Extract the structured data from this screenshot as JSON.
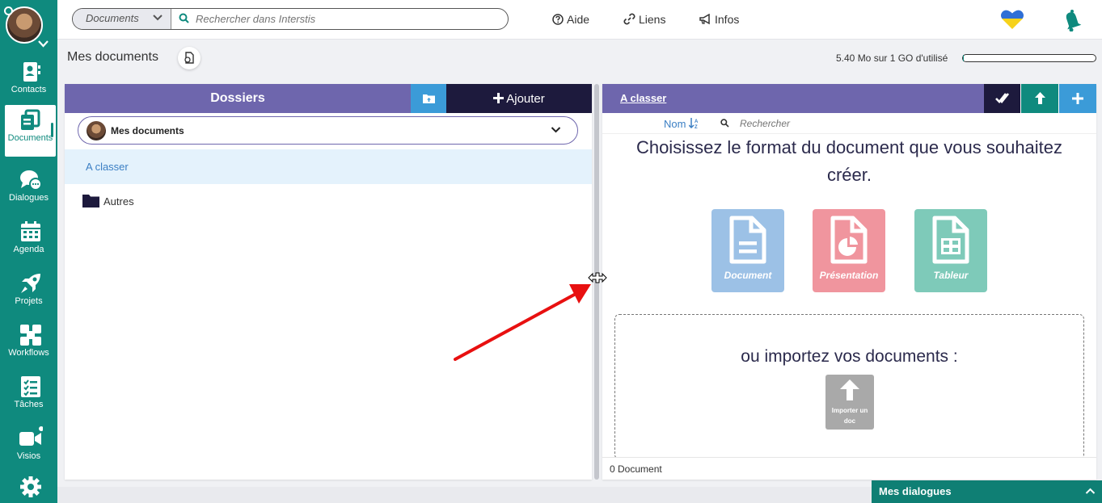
{
  "sidebar": {
    "items": [
      {
        "label": "Contacts",
        "icon": "contacts-icon"
      },
      {
        "label": "Documents",
        "icon": "documents-icon",
        "active": true
      },
      {
        "label": "Dialogues",
        "icon": "chat-icon"
      },
      {
        "label": "Agenda",
        "icon": "calendar-icon"
      },
      {
        "label": "Projets",
        "icon": "rocket-icon"
      },
      {
        "label": "Workflows",
        "icon": "workflow-icon"
      },
      {
        "label": "Tâches",
        "icon": "tasks-icon"
      },
      {
        "label": "Visios",
        "icon": "video-icon"
      }
    ],
    "settings_icon": "gear-icon"
  },
  "topbar": {
    "scope": "Documents",
    "search_placeholder": "Rechercher dans Interstis",
    "links": [
      "Aide",
      "Liens",
      "Infos"
    ]
  },
  "page": {
    "title": "Mes documents",
    "quota_text": "5.40 Mo sur 1 GO d'utilisé",
    "quota_fraction": 0.0054
  },
  "left_panel": {
    "header": "Dossiers",
    "add_label": "Ajouter",
    "selector": "Mes documents",
    "folders": [
      "A classer",
      "Autres"
    ]
  },
  "right_panel": {
    "breadcrumb": "A classer",
    "sort_label": "Nom",
    "search_placeholder": "Rechercher",
    "create_title": "Choisissez le format du document que vous souhaitez créer.",
    "formats": [
      {
        "label": "Document",
        "color": "#9cc1e6"
      },
      {
        "label": "Présentation",
        "color": "#f0959e"
      },
      {
        "label": "Tableur",
        "color": "#7ecab9"
      }
    ],
    "import_title": "ou importez vos documents :",
    "import_button": "Importer un doc",
    "footer": "0 Document"
  },
  "dialogs": {
    "label": "Mes dialogues"
  },
  "colors": {
    "sidebar": "#0f8a7e",
    "panel_header": "#6e66ad",
    "dark_button": "#1d1a3d",
    "blue_button": "#3b9bd8",
    "annotation_arrow": "#e81010"
  }
}
